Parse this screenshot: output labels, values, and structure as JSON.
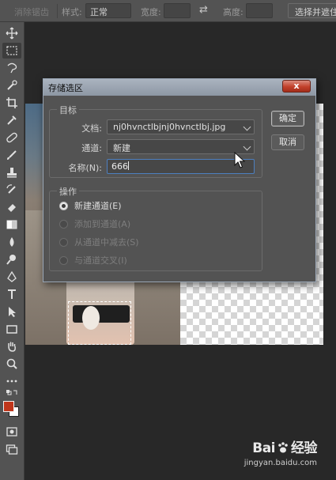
{
  "options_bar": {
    "feather_label": "消除锯齿",
    "style_label": "样式:",
    "style_value": "正常",
    "width_label": "宽度:",
    "height_label": "高度:",
    "select_mask_label": "选择并遮住..."
  },
  "toolbar": {
    "tools": [
      "move-icon",
      "marquee-icon",
      "lasso-icon",
      "quick-select-icon",
      "crop-icon",
      "eyedropper-icon",
      "healing-brush-icon",
      "brush-icon",
      "clone-stamp-icon",
      "history-brush-icon",
      "eraser-icon",
      "gradient-icon",
      "blur-icon",
      "dodge-icon",
      "pen-icon",
      "type-icon",
      "path-select-icon",
      "rectangle-icon",
      "hand-icon",
      "zoom-icon",
      "more-tools-icon",
      "swap-colors-icon",
      "color-swatch-icon",
      "quick-mask-icon",
      "screen-mode-icon"
    ],
    "foreground_color": "#c0361b",
    "background_color": "#ffffff"
  },
  "dialog": {
    "title": "存储选区",
    "close_label": "x",
    "target_group": {
      "title": "目标",
      "document_label": "文档:",
      "document_value": "nj0hvnctlbjnj0hvnctlbj.jpg",
      "channel_label": "通道:",
      "channel_value": "新建",
      "name_label": "名称(N):",
      "name_value": "666"
    },
    "operation_group": {
      "title": "操作",
      "options": [
        {
          "label": "新建通道(E)",
          "selected": true,
          "enabled": true
        },
        {
          "label": "添加到通道(A)",
          "selected": false,
          "enabled": false
        },
        {
          "label": "从通道中减去(S)",
          "selected": false,
          "enabled": false
        },
        {
          "label": "与通道交叉(I)",
          "selected": false,
          "enabled": false
        }
      ]
    },
    "ok_label": "确定",
    "cancel_label": "取消"
  },
  "watermark": {
    "brand_left": "Bai",
    "brand_right": "经验",
    "url": "jingyan.baidu.com"
  }
}
